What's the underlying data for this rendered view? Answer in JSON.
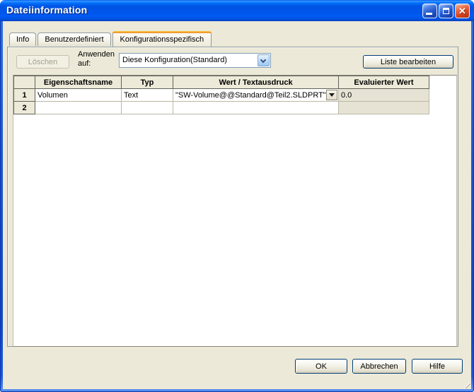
{
  "window": {
    "title": "Dateiinformation"
  },
  "icons": {
    "close_glyph": "✕",
    "minimize_icon": "underscore-bar",
    "maximize_icon": "square-outline",
    "combo_chevron": "chevron-down",
    "cell_dropdown": "triangle-down"
  },
  "tabs": [
    {
      "label": "Info",
      "active": false
    },
    {
      "label": "Benutzerdefiniert",
      "active": false
    },
    {
      "label": "Konfigurationsspezifisch",
      "active": true
    }
  ],
  "toolbar": {
    "delete_button": "Löschen",
    "apply_to_label": "Anwenden auf:",
    "configuration_select": {
      "value": "Diese Konfiguration(Standard)"
    },
    "edit_list_button": "Liste bearbeiten"
  },
  "table": {
    "headers": {
      "name": "Eigenschaftsname",
      "type": "Typ",
      "value": "Wert / Textausdruck",
      "evaluated": "Evaluierter Wert"
    },
    "rows": [
      {
        "num": "1",
        "name": "Volumen",
        "type": "Text",
        "value": "\"SW-Volume@@Standard@Teil2.SLDPRT\"",
        "evaluated": "0.0"
      },
      {
        "num": "2",
        "name": "",
        "type": "",
        "value": "",
        "evaluated": ""
      }
    ]
  },
  "footer": {
    "ok": "OK",
    "cancel": "Abbrechen",
    "help": "Hilfe"
  },
  "colors": {
    "titlebar_blue": "#0054E3",
    "dialog_bg": "#ECE9D8",
    "active_tab_accent": "#E68B2C",
    "readonly_cell_bg": "#E6E3D4",
    "combo_border": "#7F9DB9",
    "close_red": "#D9431E"
  }
}
